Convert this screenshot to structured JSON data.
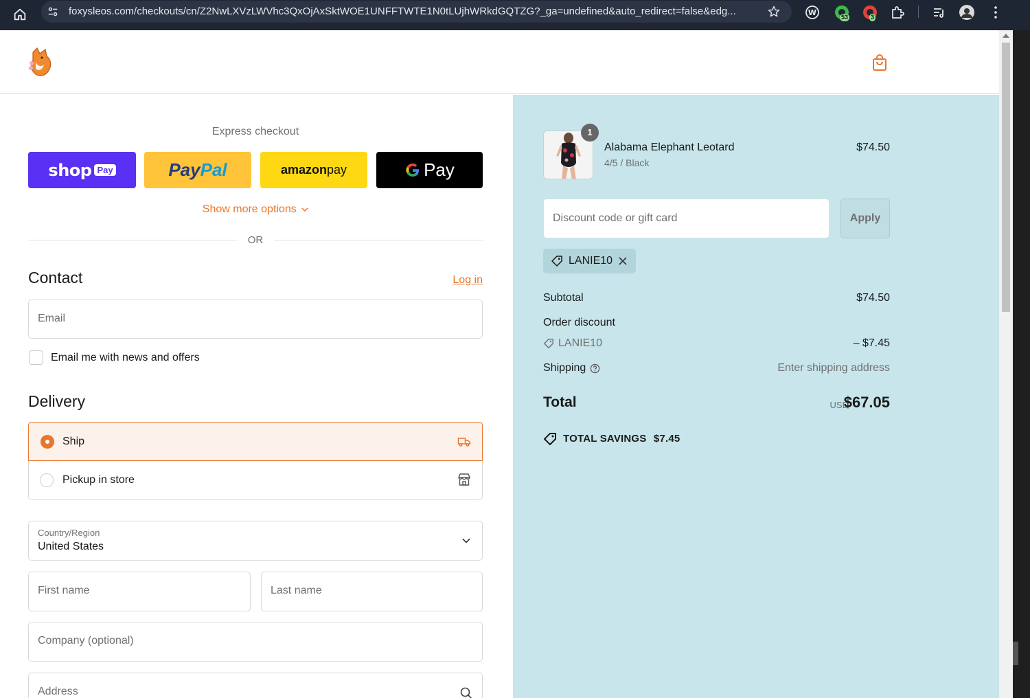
{
  "browser": {
    "url": "foxysleos.com/checkouts/cn/Z2NwLXVzLWVhc3QxOjAxSktWOE1UNFFTWTE1N0tLUjhWRkdGQTZG?_ga=undefined&auto_redirect=false&edg...",
    "ext_badge_1": "53",
    "ext_badge_2": "3"
  },
  "colors": {
    "accent": "#e8762c",
    "summary_bg": "#c7e5ea",
    "shop_pay": "#5a31f4",
    "paypal": "#ffc439",
    "amazon_pay": "#ffd814",
    "google_pay": "#000000"
  },
  "express": {
    "title": "Express checkout",
    "shop_pay_label": "shop",
    "shop_pay_badge": "Pay",
    "paypal_label_a": "Pay",
    "paypal_label_b": "Pal",
    "amazon_label_a": "amazon",
    "amazon_label_b": " pay",
    "gpay_label": "Pay",
    "show_more": "Show more options",
    "or": "OR"
  },
  "contact": {
    "heading": "Contact",
    "login": "Log in",
    "email_placeholder": "Email",
    "newsletter_label": "Email me with news and offers"
  },
  "delivery": {
    "heading": "Delivery",
    "options": [
      {
        "label": "Ship",
        "icon": "truck-icon",
        "selected": true
      },
      {
        "label": "Pickup in store",
        "icon": "store-icon",
        "selected": false
      }
    ],
    "country_label": "Country/Region",
    "country_value": "United States",
    "first_name": "First name",
    "last_name": "Last name",
    "company": "Company (optional)",
    "address": "Address"
  },
  "summary": {
    "item": {
      "quantity": "1",
      "name": "Alabama Elephant Leotard",
      "variant": "4/5 / Black",
      "price": "$74.50"
    },
    "discount_placeholder": "Discount code or gift card",
    "apply_label": "Apply",
    "applied_code": "LANIE10",
    "subtotal_label": "Subtotal",
    "subtotal_value": "$74.50",
    "order_discount_label": "Order discount",
    "discount_code": "LANIE10",
    "discount_value": "– $7.45",
    "shipping_label": "Shipping",
    "shipping_value": "Enter shipping address",
    "total_label": "Total",
    "total_currency": "USD",
    "total_value": "$67.05",
    "savings_label": "TOTAL SAVINGS",
    "savings_value": "$7.45"
  }
}
